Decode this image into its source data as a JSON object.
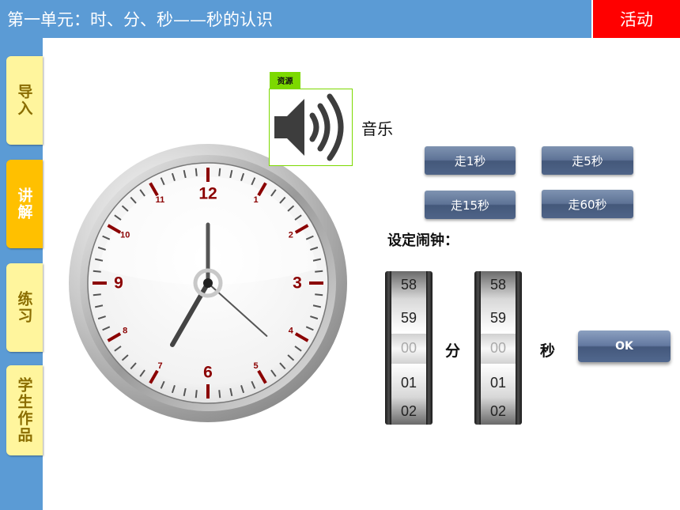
{
  "header": {
    "title": "第一单元：时、分、秒——秒的认识",
    "activity_button": "活动"
  },
  "sidebar": {
    "items": [
      {
        "label": "导入",
        "active": false
      },
      {
        "label": "讲解",
        "active": true
      },
      {
        "label": "练习",
        "active": false
      },
      {
        "label": "学生作品",
        "active": false
      }
    ]
  },
  "resource": {
    "badge": "资源",
    "label": "音乐",
    "icon": "speaker-icon"
  },
  "step_buttons": [
    "走1秒",
    "走5秒",
    "走15秒",
    "走60秒"
  ],
  "alarm": {
    "label": "设定闹钟：",
    "minute_drum": [
      "58",
      "59",
      "00",
      "01",
      "02"
    ],
    "second_drum": [
      "58",
      "59",
      "00",
      "01",
      "02"
    ],
    "minute_unit": "分",
    "second_unit": "秒",
    "ok_label": "OK"
  },
  "clock": {
    "numbers": [
      "12",
      "1",
      "2",
      "3",
      "4",
      "5",
      "6",
      "7",
      "8",
      "9",
      "10",
      "11"
    ],
    "time": {
      "hour": 7,
      "minute": 0,
      "second": 22
    },
    "accent": "#8b0000"
  }
}
